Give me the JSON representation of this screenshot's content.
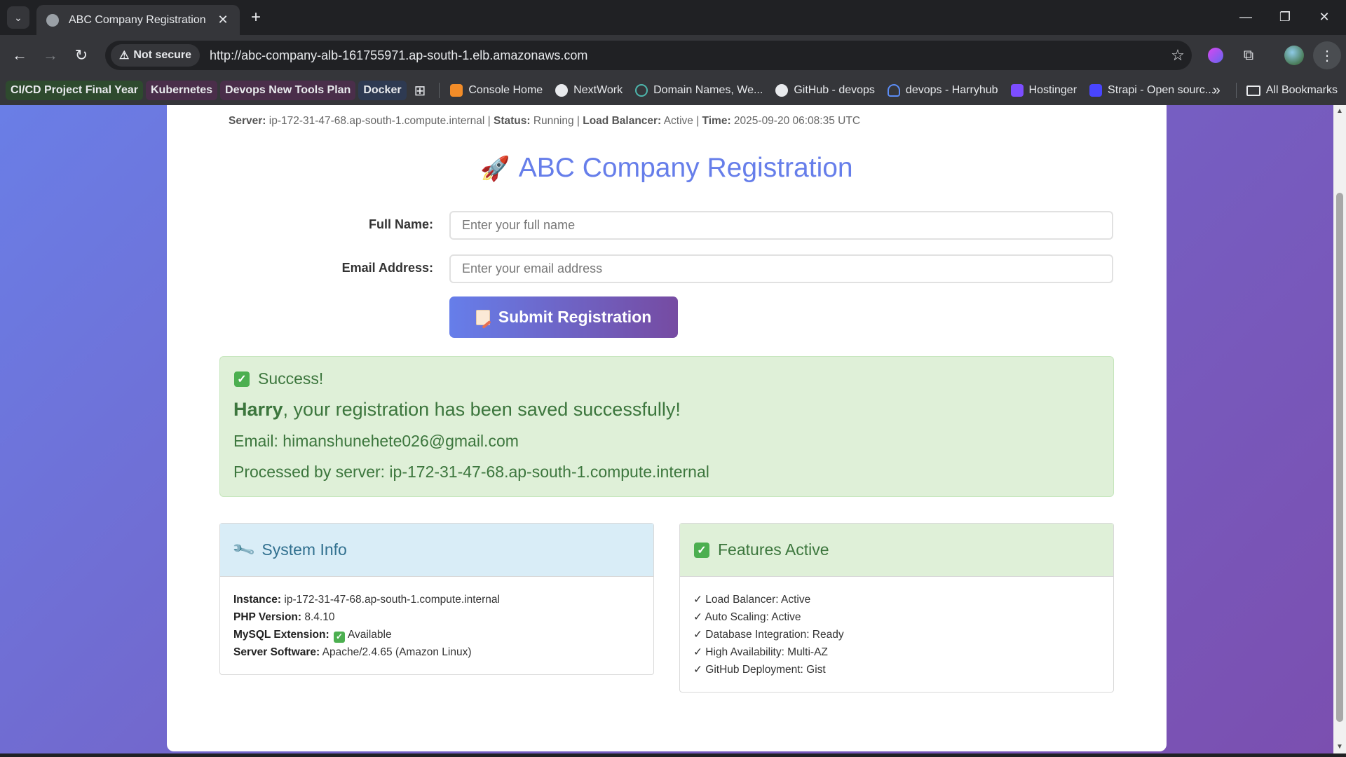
{
  "browser": {
    "tab_title": "ABC Company Registration",
    "security_label": "Not secure",
    "url": "http://abc-company-alb-161755971.ap-south-1.elb.amazonaws.com",
    "bookmarks": [
      {
        "label": "CI/CD Project Final Year",
        "style": "pill",
        "color": "#2e4a2e"
      },
      {
        "label": "Kubernetes",
        "style": "pill",
        "color": "#4a2e4a"
      },
      {
        "label": "Devops New Tools Plan",
        "style": "pill",
        "color": "#4a2e4a"
      },
      {
        "label": "Docker",
        "style": "pill",
        "color": "#2e3a52"
      },
      {
        "label": "Console Home",
        "icon_color": "#f28c28"
      },
      {
        "label": "NextWork",
        "icon_color": "#e8eaed"
      },
      {
        "label": "Domain Names, We...",
        "icon_color": "#4db6ac"
      },
      {
        "label": "GitHub - devops",
        "icon_color": "#e8eaed"
      },
      {
        "label": "devops - Harryhub",
        "icon_color": "#5c8df6"
      },
      {
        "label": "Hostinger",
        "icon_color": "#7c4dff"
      },
      {
        "label": "Strapi - Open sourc...",
        "icon_color": "#4945ff"
      }
    ],
    "all_bookmarks_label": "All Bookmarks"
  },
  "page": {
    "server_bar": {
      "server_label": "Server:",
      "server_value": "ip-172-31-47-68.ap-south-1.compute.internal",
      "status_label": "Status:",
      "status_value": "Running",
      "lb_label": "Load Balancer:",
      "lb_value": "Active",
      "time_label": "Time:",
      "time_value": "2025-09-20 06:08:35 UTC"
    },
    "title": "ABC Company Registration",
    "form": {
      "name_label": "Full Name:",
      "name_placeholder": "Enter your full name",
      "email_label": "Email Address:",
      "email_placeholder": "Enter your email address",
      "submit_label": "Submit Registration"
    },
    "success": {
      "heading": "Success!",
      "name": "Harry",
      "message": ", your registration has been saved successfully!",
      "email_line": "Email: himanshunehete026@gmail.com",
      "server_line": "Processed by server: ip-172-31-47-68.ap-south-1.compute.internal"
    },
    "system_info": {
      "heading": "System Info",
      "rows": [
        {
          "label": "Instance:",
          "value": "ip-172-31-47-68.ap-south-1.compute.internal"
        },
        {
          "label": "PHP Version:",
          "value": "8.4.10"
        },
        {
          "label": "MySQL Extension:",
          "value": "Available"
        },
        {
          "label": "Server Software:",
          "value": "Apache/2.4.65 (Amazon Linux)"
        }
      ]
    },
    "features": {
      "heading": "Features Active",
      "items": [
        "✓ Load Balancer: Active",
        "✓ Auto Scaling: Active",
        "✓ Database Integration: Ready",
        "✓ High Availability: Multi-AZ",
        "✓ GitHub Deployment: Gist"
      ]
    }
  }
}
